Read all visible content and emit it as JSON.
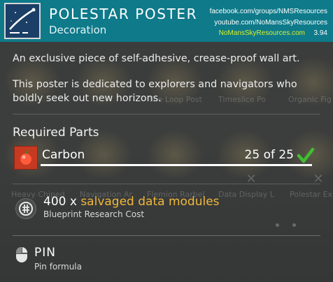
{
  "header": {
    "title": "POLESTAR POSTER",
    "subtitle": "Decoration",
    "watermark": {
      "facebook": "facebook.com/groups/NMSResources",
      "youtube": "youtube.com/NoMansSkyResources",
      "site": "NoMansSkyResources.com",
      "version": "3.94"
    }
  },
  "description": {
    "line1": "An exclusive piece of self-adhesive, crease-proof wall art.",
    "line2": "This poster is dedicated to explorers and navigators who boldly seek out new horizons."
  },
  "background": {
    "row1_labels": [
      "The Loop Post",
      "Timeslice Po",
      "Organic Fig"
    ],
    "row2_labels": [
      "Heavy Chiped",
      "Navigation Ar",
      "Flemion Rarbel",
      "Data Display L",
      "Polestar Ex"
    ]
  },
  "required_parts": {
    "title": "Required Parts",
    "items": [
      {
        "name": "Carbon",
        "count_text": "25 of 25",
        "have": 25,
        "need": 25,
        "progress_fraction": 1.0,
        "icon": "carbon-icon",
        "complete_icon": "checkmark-icon"
      }
    ]
  },
  "blueprint": {
    "quantity": "400",
    "multiplier": "x",
    "item": "salvaged data modules",
    "caption": "Blueprint Research Cost",
    "icon": "salvaged-data-icon"
  },
  "pin": {
    "label": "PIN",
    "caption": "Pin formula",
    "icon": "mouse-icon"
  },
  "colors": {
    "header_bg": "#0e7a8a",
    "accent_item": "#f0b73a",
    "check_green": "#3fbf2f",
    "part_icon_bg": "#c63a22",
    "watermark_green": "#d9ef2b"
  }
}
